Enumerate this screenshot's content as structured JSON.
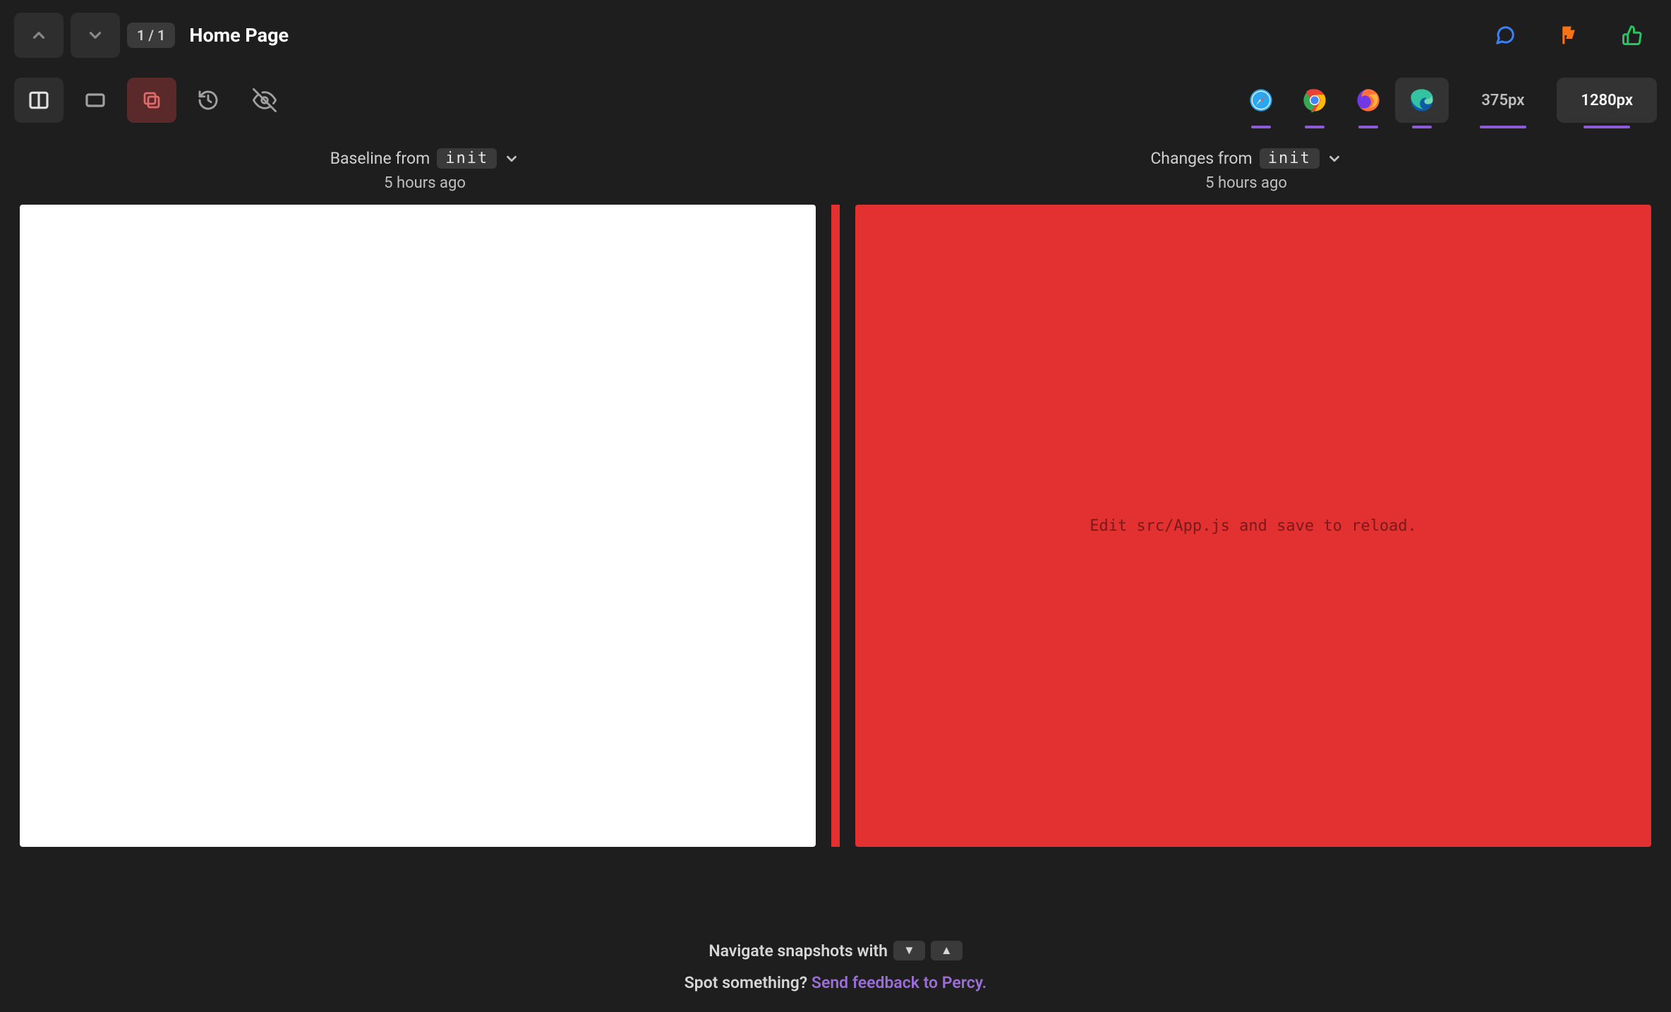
{
  "header": {
    "counter": "1 / 1",
    "title": "Home Page"
  },
  "toolbar": {
    "browsers": [
      "safari",
      "chrome",
      "firefox",
      "edge"
    ],
    "selected_browser": "edge",
    "viewports": {
      "small": "375px",
      "large": "1280px"
    },
    "selected_viewport": "1280px"
  },
  "baseline": {
    "label": "Baseline from",
    "ref": "init",
    "time": "5 hours ago"
  },
  "changes": {
    "label": "Changes from",
    "ref": "init",
    "time": "5 hours ago"
  },
  "pane_right": {
    "prefix": "Edit ",
    "code": "src/App.js",
    "suffix": " and save to reload."
  },
  "footer": {
    "nav_hint": "Navigate snapshots with",
    "down_key": "▼",
    "up_key": "▲",
    "spot_prefix": "Spot something? ",
    "spot_link": "Send feedback to Percy."
  },
  "colors": {
    "purple": "#8e5bd6",
    "red": "#e33030",
    "blue": "#3b82f6",
    "orange": "#f97316",
    "green": "#22c55e"
  }
}
